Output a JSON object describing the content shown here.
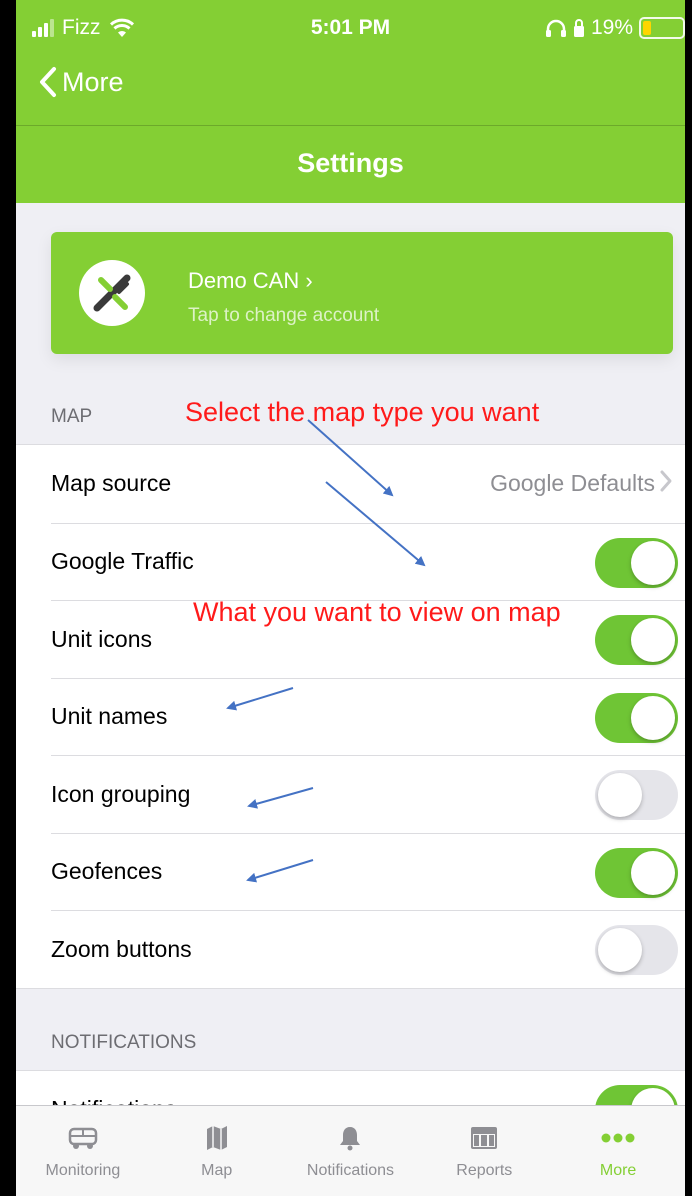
{
  "status_bar": {
    "carrier": "Fizz",
    "time": "5:01 PM",
    "battery": "19%"
  },
  "nav": {
    "back_label": "More",
    "title": "Settings"
  },
  "account": {
    "name": "Demo CAN  ›",
    "subtitle": "Tap to change account"
  },
  "map_section": {
    "header": "MAP",
    "rows": [
      {
        "label": "Map source",
        "value": "Google Defaults"
      },
      {
        "label": "Google Traffic",
        "on": true
      },
      {
        "label": "Unit icons",
        "on": true
      },
      {
        "label": "Unit names",
        "on": true
      },
      {
        "label": "Icon grouping",
        "on": false
      },
      {
        "label": "Geofences",
        "on": true
      },
      {
        "label": "Zoom buttons",
        "on": false
      }
    ]
  },
  "notifications_section": {
    "header": "NOTIFICATIONS",
    "rows": [
      {
        "label": "Notifications",
        "on": true
      }
    ]
  },
  "annotations": {
    "select_map_type": "Select the map type you want",
    "view_on_map": "What you want to view on map"
  },
  "tabbar": [
    {
      "label": "Monitoring",
      "icon": "bus-icon"
    },
    {
      "label": "Map",
      "icon": "map-icon"
    },
    {
      "label": "Notifications",
      "icon": "bell-icon"
    },
    {
      "label": "Reports",
      "icon": "table-icon"
    },
    {
      "label": "More",
      "icon": "more-dots-icon",
      "active": true
    }
  ],
  "colors": {
    "brand_green": "#84cf34",
    "toggle_on": "#6fc535",
    "annotation_red": "#ff1a1a",
    "arrow_blue": "#4472c4"
  }
}
